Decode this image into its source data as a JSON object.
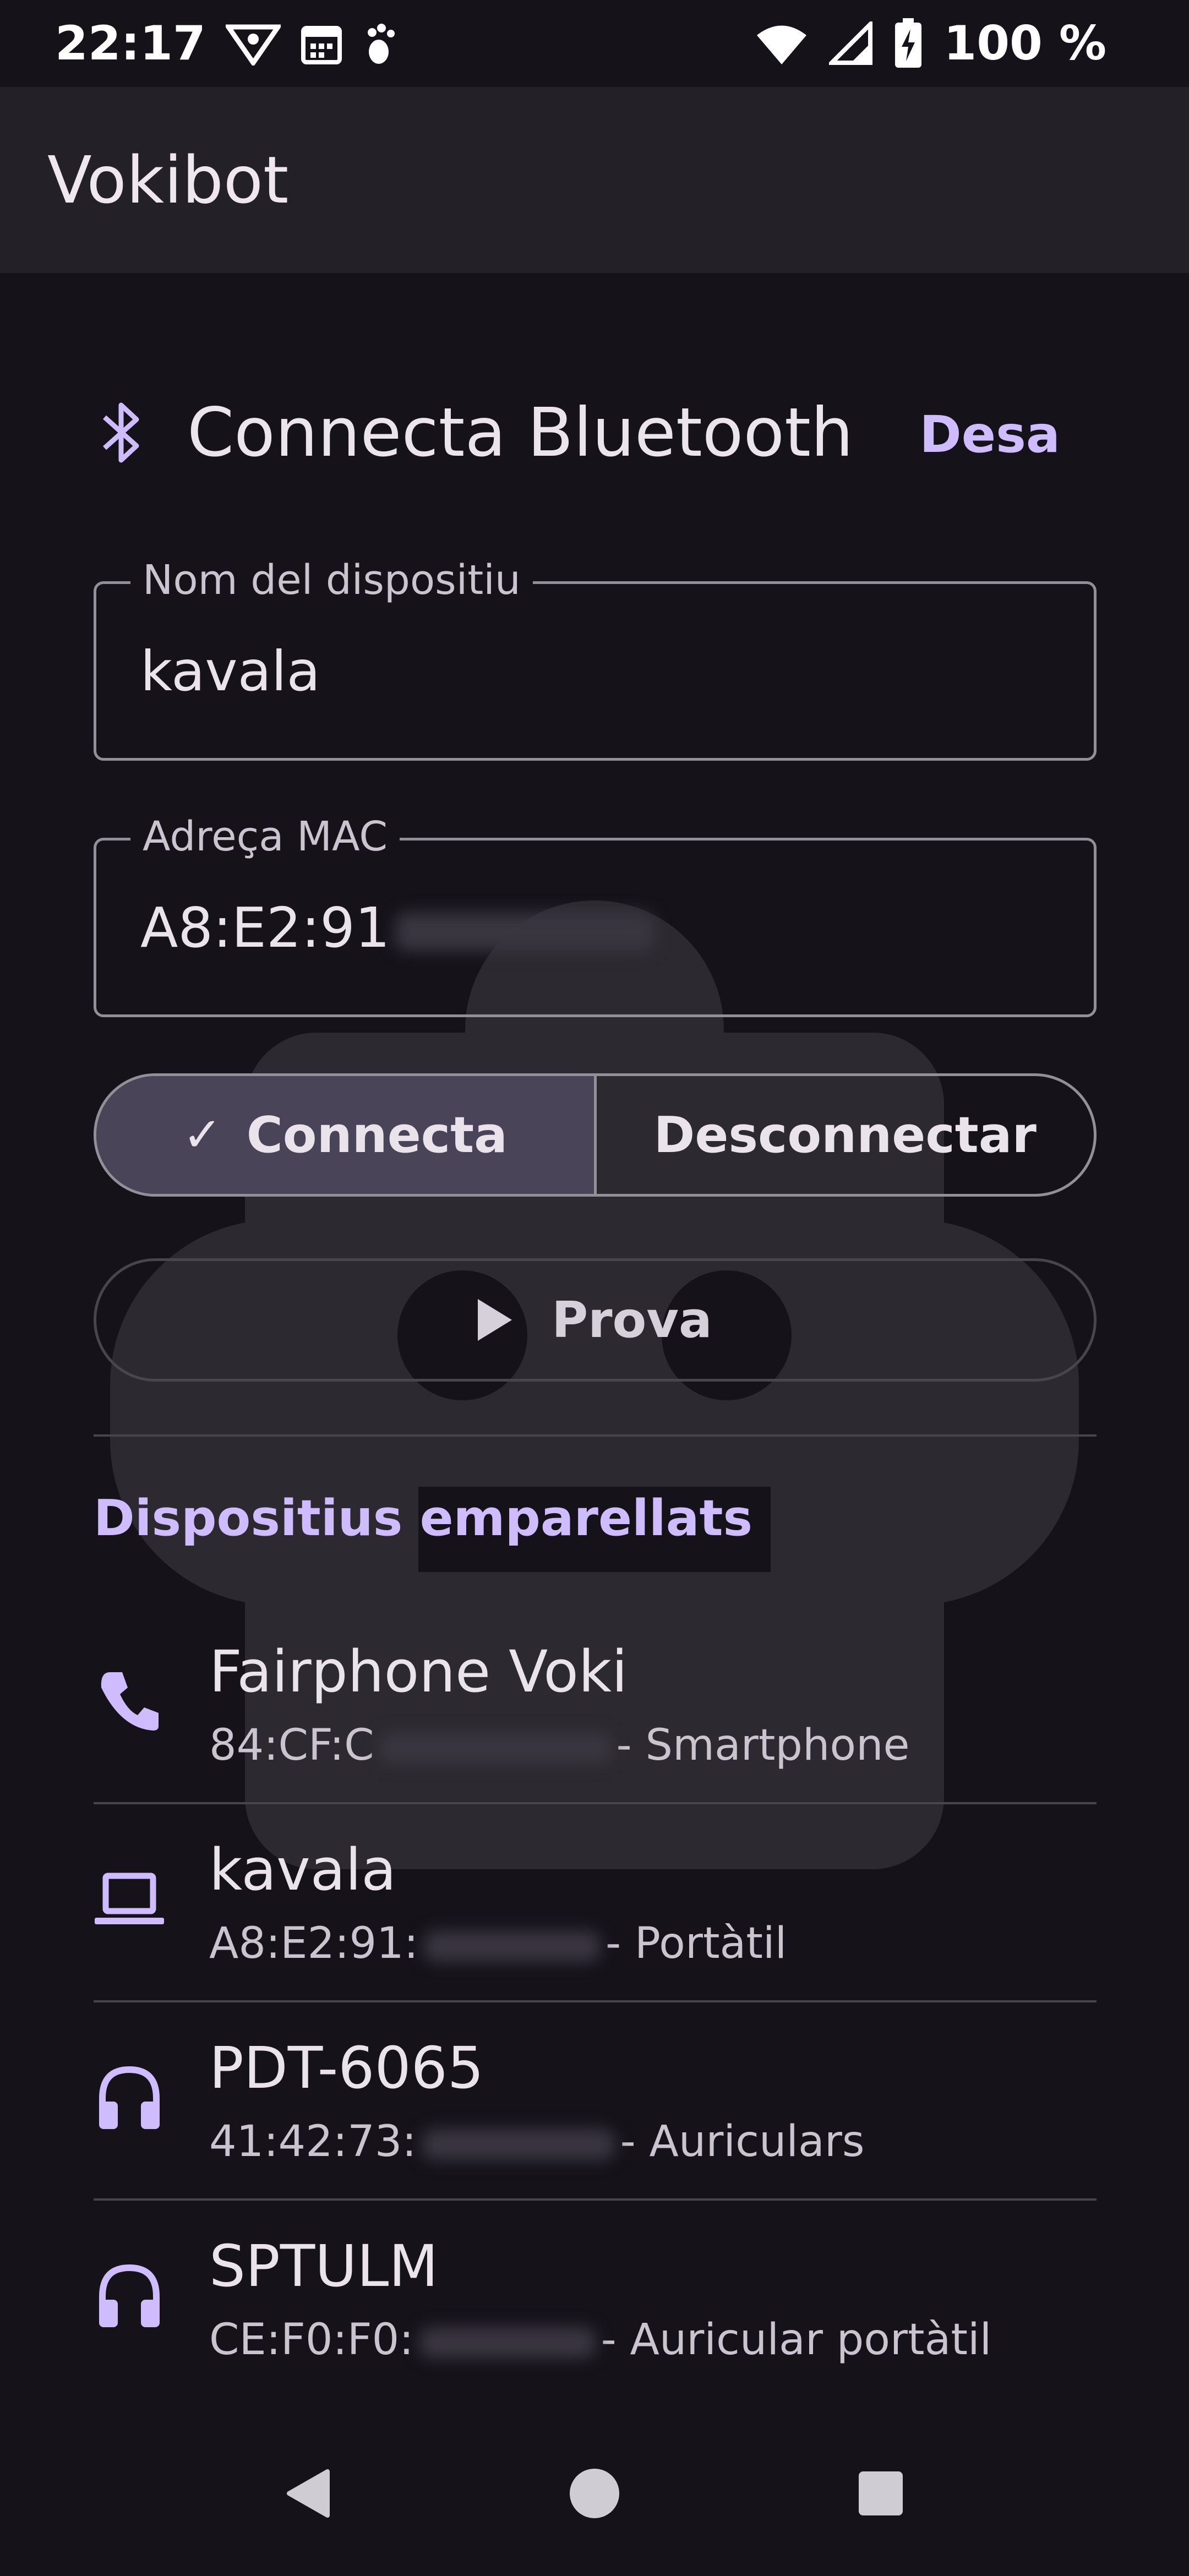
{
  "status_bar": {
    "time": "22:17",
    "battery": "100 %",
    "icons": [
      "vpn-key-icon",
      "calendar-icon",
      "footprint-icon",
      "wifi-icon",
      "signal-icon",
      "battery-charging-icon"
    ]
  },
  "app_bar": {
    "title": "Vokibot"
  },
  "panel": {
    "title": "Connecta Bluetooth",
    "icon": "bluetooth-icon",
    "save_label": "Desa"
  },
  "fields": {
    "device_name": {
      "label": "Nom del dispositiu",
      "value": "kavala"
    },
    "mac": {
      "label": "Adreça MAC",
      "value": "A8:E2:91"
    }
  },
  "segmented": {
    "connect_label": "Connecta",
    "disconnect_label": "Desconnectar",
    "selected": "connect"
  },
  "test_label": "Prova",
  "paired": {
    "title": "Dispositius emparellats",
    "devices": [
      {
        "name": "Fairphone Voki",
        "mac_prefix": "84:CF:C",
        "type": "- Smartphone",
        "icon": "phone-icon"
      },
      {
        "name": "kavala",
        "mac_prefix": "A8:E2:91:",
        "type": "- Portàtil",
        "icon": "laptop-icon"
      },
      {
        "name": "PDT-6065",
        "mac_prefix": "41:42:73:",
        "type": "- Auriculars",
        "icon": "headphones-icon"
      },
      {
        "name": "SPTULM",
        "mac_prefix": "CE:F0:F0:",
        "type": "- Auricular portàtil",
        "icon": "headphones-icon"
      }
    ]
  },
  "colors": {
    "accent": "#cfbcff",
    "background": "#15121a",
    "app_bar": "#232028",
    "selected_segment": "#4a4458"
  }
}
